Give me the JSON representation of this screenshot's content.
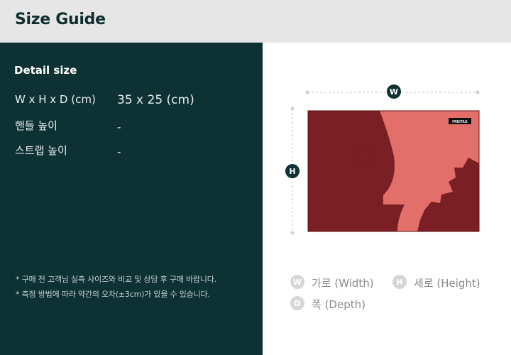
{
  "header": {
    "title": "Size Guide"
  },
  "detail": {
    "title": "Detail size",
    "rows": [
      {
        "label": "W x H x D (cm)",
        "value": "35 x 25 (cm)"
      },
      {
        "label": "핸들 높이",
        "value": "-"
      },
      {
        "label": "스트랩 높이",
        "value": "-"
      }
    ],
    "notes": [
      "* 구매 전 고객님 실측 사이즈와 비교 및 상담 후 구매 바랍니다.",
      "* 측정 방법에 따라 약간의 오차(±3cm)가 있을 수 있습니다."
    ]
  },
  "diagram": {
    "width_badge": "W",
    "height_badge": "H",
    "brand_tag": "FREITAG",
    "colors": {
      "base": "#e26f6a",
      "dark": "#7a1f24",
      "badge": "#0e3133"
    }
  },
  "legend": [
    {
      "badge": "W",
      "label": "가로 (Width)"
    },
    {
      "badge": "H",
      "label": "세로 (Height)"
    },
    {
      "badge": "D",
      "label": "폭 (Depth)"
    }
  ]
}
